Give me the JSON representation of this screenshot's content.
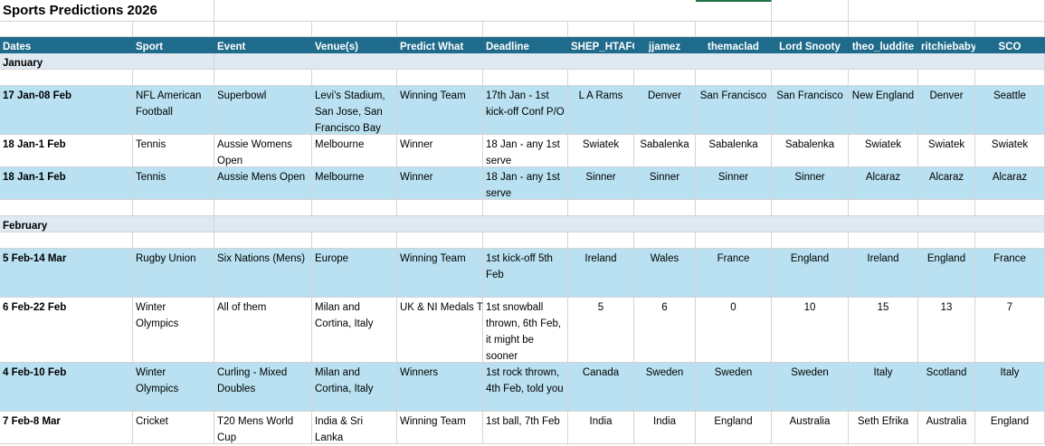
{
  "sheet": {
    "title": "Sports Predictions 2026",
    "headers": [
      "Dates",
      "Sport",
      "Event",
      "Venue(s)",
      "Predict What",
      "Deadline",
      "SHEP_HTAFC",
      "jjamez",
      "themaclad",
      "Lord Snooty",
      "theo_luddite",
      "ritchiebaby",
      "SCO"
    ],
    "months": {
      "january": "January",
      "february": "February"
    },
    "rows": [
      {
        "date": "17 Jan-08 Feb",
        "sport": "NFL American Football",
        "event": "Superbowl",
        "venue": "Levi's Stadium, San Jose, San Francisco Bay",
        "predict": "Winning Team",
        "deadline": "17th Jan - 1st kick-off Conf P/O",
        "picks": [
          "L A Rams",
          "Denver",
          "San Francisco",
          "San Francisco",
          "New England",
          "Denver",
          "Seattle"
        ]
      },
      {
        "date": "18 Jan-1 Feb",
        "sport": "Tennis",
        "event": "Aussie Womens Open",
        "venue": "Melbourne",
        "predict": "Winner",
        "deadline": "18 Jan - any 1st serve",
        "picks": [
          "Swiatek",
          "Sabalenka",
          "Sabalenka",
          "Sabalenka",
          "Swiatek",
          "Swiatek",
          "Swiatek"
        ]
      },
      {
        "date": "18 Jan-1 Feb",
        "sport": "Tennis",
        "event": "Aussie Mens Open",
        "venue": "Melbourne",
        "predict": "Winner",
        "deadline": "18 Jan - any 1st serve",
        "picks": [
          "Sinner",
          "Sinner",
          "Sinner",
          "Sinner",
          "Alcaraz",
          "Alcaraz",
          "Alcaraz"
        ]
      },
      {
        "date": "5 Feb-14 Mar",
        "sport": "Rugby Union",
        "event": "Six Nations (Mens)",
        "venue": "Europe",
        "predict": "Winning Team",
        "deadline": "1st kick-off 5th Feb",
        "picks": [
          "Ireland",
          "Wales",
          "France",
          "England",
          "Ireland",
          "England",
          "France"
        ]
      },
      {
        "date": "6 Feb-22 Feb",
        "sport": "Winter Olympics",
        "event": "All of them",
        "venue": "Milan and Cortina, Italy",
        "predict": "UK & NI Medals T",
        "deadline": "1st snowball thrown, 6th Feb, it might be sooner",
        "picks": [
          "5",
          "6",
          "0",
          "10",
          "15",
          "13",
          "7"
        ]
      },
      {
        "date": "4 Feb-10 Feb",
        "sport": "Winter Olympics",
        "event": "Curling - Mixed Doubles",
        "venue": "Milan and Cortina, Italy",
        "predict": "Winners",
        "deadline": "1st rock thrown, 4th Feb, told you",
        "picks": [
          "Canada",
          "Sweden",
          "Sweden",
          "Sweden",
          "Italy",
          "Scotland",
          "Italy"
        ]
      },
      {
        "date": "7 Feb-8 Mar",
        "sport": "Cricket",
        "event": "T20 Mens World Cup",
        "venue": "India & Sri Lanka",
        "predict": "Winning Team",
        "deadline": "1st ball, 7th Feb",
        "picks": [
          "India",
          "India",
          "England",
          "Australia",
          "Seth Efrika",
          "Australia",
          "England"
        ]
      }
    ]
  }
}
